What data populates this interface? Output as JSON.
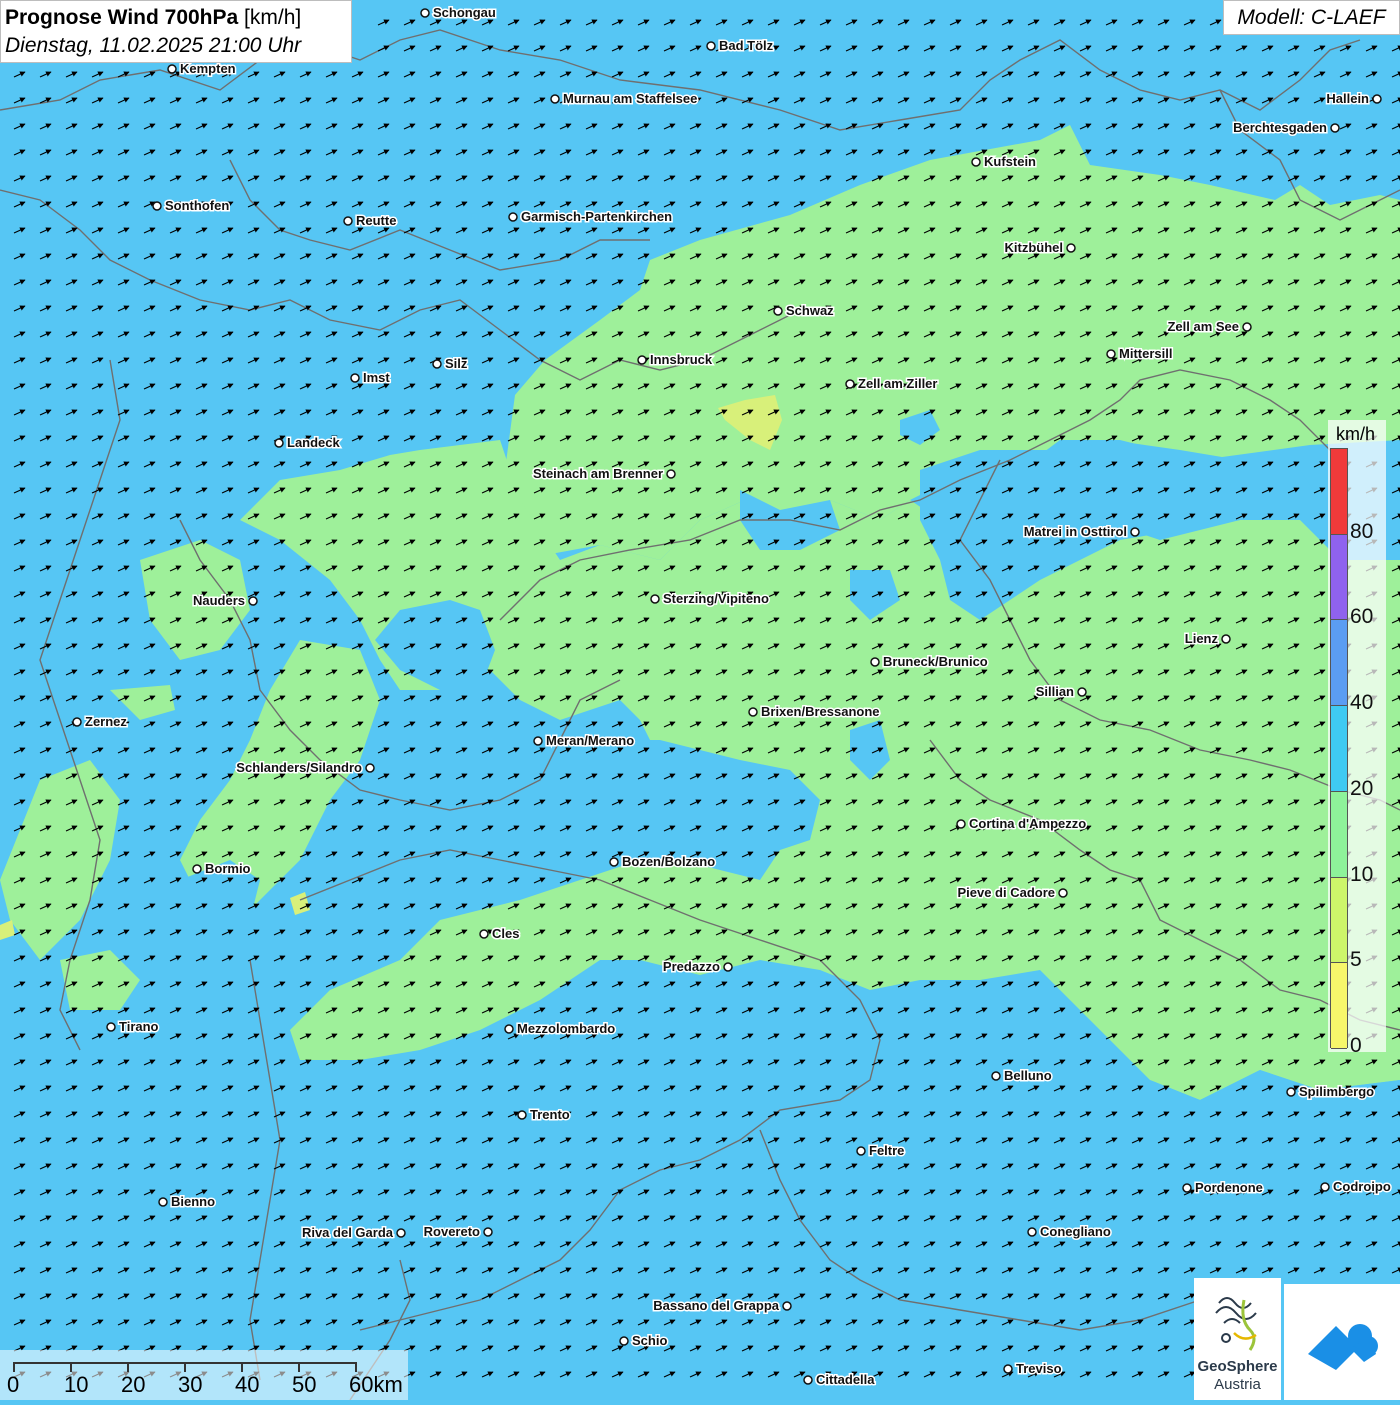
{
  "title": {
    "main": "Prognose Wind 700hPa",
    "unit": "[km/h]",
    "datetime": "Dienstag, 11.02.2025 21:00 Uhr"
  },
  "model": "Modell: C-LAEF",
  "colors": {
    "water_blue": "#56c6f4",
    "light_green": "#9ef09a",
    "yellow_green": "#d8f07a",
    "border_gray": "#6f6f6f",
    "arrow": "#000000"
  },
  "legend": {
    "unit": "km/h",
    "bins": [
      {
        "from": 0,
        "to": 5,
        "color": "#f7f76b"
      },
      {
        "from": 5,
        "to": 10,
        "color": "#cdf56a"
      },
      {
        "from": 10,
        "to": 20,
        "color": "#8ef29a"
      },
      {
        "from": 20,
        "to": 40,
        "color": "#3fcaf2"
      },
      {
        "from": 40,
        "to": 60,
        "color": "#5b9df2"
      },
      {
        "from": 60,
        "to": 80,
        "color": "#8f62ee"
      },
      {
        "from": 80,
        "to": 100,
        "color": "#f03a3a"
      }
    ],
    "labels": [
      "80",
      "60",
      "40",
      "20",
      "10",
      "5",
      "0"
    ]
  },
  "scale_bar": {
    "labels": [
      "0",
      "10",
      "20",
      "30",
      "40",
      "50",
      "60km"
    ]
  },
  "logos": {
    "geosphere_line1": "GeoSphere",
    "geosphere_line2": "Austria",
    "geosphere_icon": "geosphere-swirl-icon",
    "second_icon": "cloud-arrow-icon"
  },
  "cities": [
    {
      "name": "Schongau"
    },
    {
      "name": "Bad Tölz"
    },
    {
      "name": "Kempten"
    },
    {
      "name": "Murnau am Staffelsee"
    },
    {
      "name": "Hallein"
    },
    {
      "name": "Berchtesgaden"
    },
    {
      "name": "Kufstein"
    },
    {
      "name": "Sonthofen"
    },
    {
      "name": "Reutte"
    },
    {
      "name": "Garmisch-Partenkirchen"
    },
    {
      "name": "Kitzbühel"
    },
    {
      "name": "Schwaz"
    },
    {
      "name": "Zell am See"
    },
    {
      "name": "Mittersill"
    },
    {
      "name": "Innsbruck"
    },
    {
      "name": "Silz"
    },
    {
      "name": "Imst"
    },
    {
      "name": "Zell am Ziller"
    },
    {
      "name": "Landeck"
    },
    {
      "name": "Steinach am Brenner"
    },
    {
      "name": "Matrei in Osttirol"
    },
    {
      "name": "Nauders"
    },
    {
      "name": "Sterzing/Vipiteno"
    },
    {
      "name": "Lienz"
    },
    {
      "name": "Bruneck/Brunico"
    },
    {
      "name": "Sillian"
    },
    {
      "name": "Brixen/Bressanone"
    },
    {
      "name": "Zernez"
    },
    {
      "name": "Meran/Merano"
    },
    {
      "name": "Schlanders/Silandro"
    },
    {
      "name": "Cortina d'Ampezzo"
    },
    {
      "name": "Bormio"
    },
    {
      "name": "Bozen/Bolzano"
    },
    {
      "name": "Pieve di Cadore"
    },
    {
      "name": "Cles"
    },
    {
      "name": "Predazzo"
    },
    {
      "name": "Tirano"
    },
    {
      "name": "Mezzolombardo"
    },
    {
      "name": "Belluno"
    },
    {
      "name": "Spilimbergo"
    },
    {
      "name": "Trento"
    },
    {
      "name": "Feltre"
    },
    {
      "name": "Pordenone"
    },
    {
      "name": "Codroipo"
    },
    {
      "name": "Bienno"
    },
    {
      "name": "Riva del Garda"
    },
    {
      "name": "Rovereto"
    },
    {
      "name": "Conegliano"
    },
    {
      "name": "Bassano del Grappa"
    },
    {
      "name": "Schio"
    },
    {
      "name": "Treviso"
    },
    {
      "name": "Cittadella"
    }
  ]
}
